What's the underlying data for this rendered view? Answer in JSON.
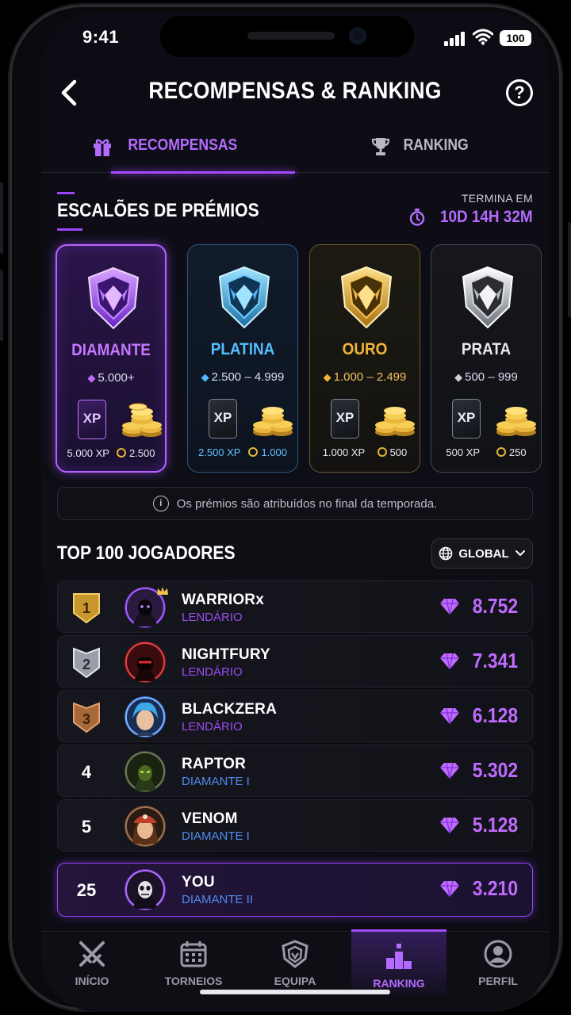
{
  "status": {
    "time": "9:41",
    "battery": "100"
  },
  "header": {
    "title": "RECOMPENSAS & RANKING",
    "help": "?"
  },
  "tabs": [
    {
      "label": "RECOMPENSAS",
      "icon": "gift-icon",
      "active": true
    },
    {
      "label": "RANKING",
      "icon": "trophy-icon",
      "active": false
    }
  ],
  "prizes": {
    "title": "ESCALÕES DE PRÉMIOS",
    "ends_label": "TERMINA EM",
    "ends_value": "10D 14H 32M",
    "tiers": [
      {
        "name": "DIAMANTE",
        "range": "5.000+",
        "card": "XP",
        "xp": "5.000 XP",
        "coins": "2.500",
        "color": "#c477ff"
      },
      {
        "name": "PLATINA",
        "range": "2.500 – 4.999",
        "card": "XP",
        "xp": "2.500 XP",
        "coins": "1.000",
        "color": "#55c0ff"
      },
      {
        "name": "OURO",
        "range": "1.000 – 2.499",
        "card": "XP",
        "xp": "1.000 XP",
        "coins": "500",
        "color": "#f0b23c"
      },
      {
        "name": "PRATA",
        "range": "500 – 999",
        "card": "XP",
        "xp": "500 XP",
        "coins": "250",
        "color": "#e8e8ee"
      }
    ],
    "info": "Os prémios são atribuídos no final da temporada.",
    "info_icon": "i"
  },
  "leaderboard": {
    "title": "TOP 100 JOGADORES",
    "filter": "GLOBAL",
    "rows": [
      {
        "rank": "1",
        "name": "WARRIORx",
        "tier": "LENDÁRIO",
        "score": "8.752"
      },
      {
        "rank": "2",
        "name": "NIGHTFURY",
        "tier": "LENDÁRIO",
        "score": "7.341"
      },
      {
        "rank": "3",
        "name": "BLACKZERA",
        "tier": "LENDÁRIO",
        "score": "6.128"
      },
      {
        "rank": "4",
        "name": "RAPTOR",
        "tier": "DIAMANTE I",
        "score": "5.302"
      },
      {
        "rank": "5",
        "name": "VENOM",
        "tier": "DIAMANTE I",
        "score": "5.128"
      }
    ],
    "me": {
      "rank": "25",
      "name": "YOU",
      "tier": "DIAMANTE II",
      "score": "3.210"
    }
  },
  "nav": [
    {
      "label": "INÍCIO",
      "icon": "swords-icon",
      "active": false
    },
    {
      "label": "TORNEIOS",
      "icon": "calendar-icon",
      "active": false
    },
    {
      "label": "EQUIPA",
      "icon": "shield-icon",
      "active": false
    },
    {
      "label": "RANKING",
      "icon": "podium-icon",
      "active": true
    },
    {
      "label": "PERFIL",
      "icon": "profile-icon",
      "active": false
    }
  ]
}
